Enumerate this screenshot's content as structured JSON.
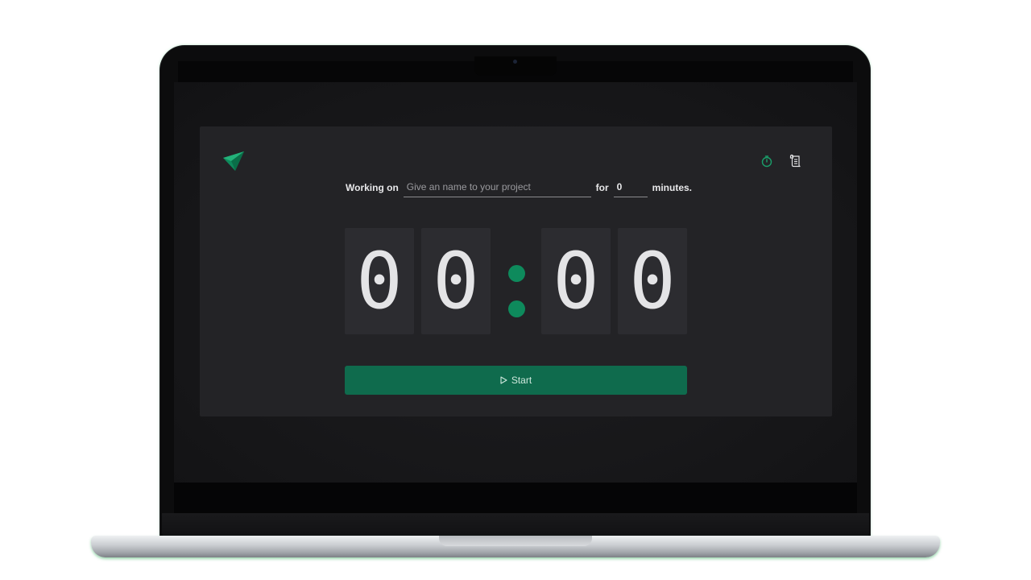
{
  "app": {
    "logo_icon": "paper-plane-icon",
    "accent_color": "#0e8a5c",
    "toolbar": {
      "timer_icon": "stopwatch-icon",
      "log_icon": "scroll-icon"
    }
  },
  "working": {
    "prefix_label": "Working on",
    "project_placeholder": "Give an name to your project",
    "project_value": "",
    "for_label": "for",
    "minutes_value": "0",
    "suffix_label": "minutes."
  },
  "timer": {
    "digits": [
      "0",
      "0",
      "0",
      "0"
    ]
  },
  "controls": {
    "start_label": "Start",
    "start_icon": "play-icon"
  }
}
